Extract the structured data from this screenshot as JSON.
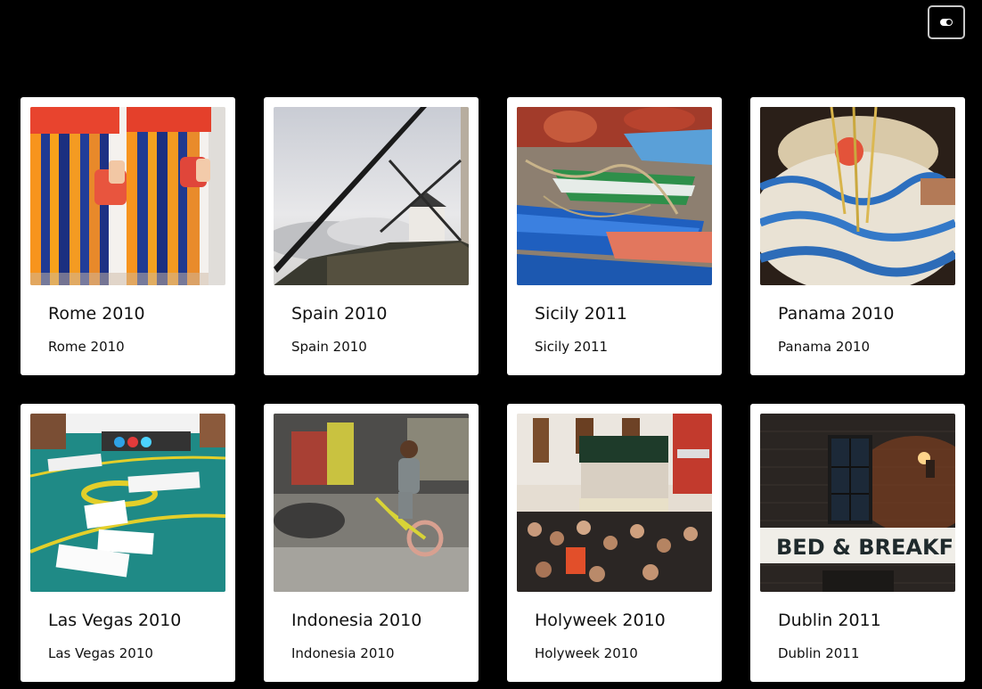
{
  "header": {
    "theme_toggle_icon": "toggle-icon"
  },
  "gallery": {
    "items": [
      {
        "title": "Rome 2010",
        "subtitle": "Rome 2010",
        "image": "swiss-guard-uniforms"
      },
      {
        "title": "Spain 2010",
        "subtitle": "Spain 2010",
        "image": "windmill-on-hill"
      },
      {
        "title": "Sicily 2011",
        "subtitle": "Sicily 2011",
        "image": "fishing-boats"
      },
      {
        "title": "Panama 2010",
        "subtitle": "Panama 2010",
        "image": "pollera-dress"
      },
      {
        "title": "Las Vegas 2010",
        "subtitle": "Las Vegas 2010",
        "image": "blackjack-table"
      },
      {
        "title": "Indonesia 2010",
        "subtitle": "Indonesia 2010",
        "image": "boy-on-bicycle"
      },
      {
        "title": "Holyweek 2010",
        "subtitle": "Holyweek 2010",
        "image": "procession-crowd"
      },
      {
        "title": "Dublin 2011",
        "subtitle": "Dublin 2011",
        "image": "bed-and-breakfast-wall"
      }
    ]
  }
}
